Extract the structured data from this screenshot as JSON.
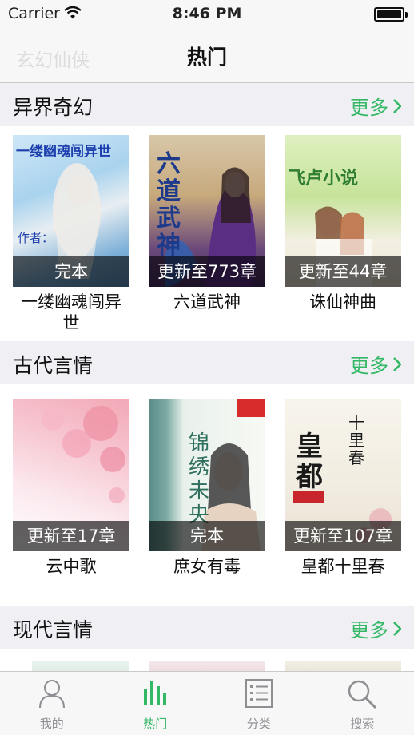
{
  "status": {
    "carrier": "Carrier",
    "time": "8:46 PM"
  },
  "nav": {
    "ghost_text": "玄幻仙侠",
    "title": "热门"
  },
  "sections": [
    {
      "name": "异界奇幻",
      "more": "更多",
      "books": [
        {
          "title": "一缕幽魂闯异世",
          "badge": "完本",
          "cover_text": "一缕幽魂闯异世",
          "cover_sub": "作者："
        },
        {
          "title": "六道武神",
          "badge": "更新至773章",
          "cover_text": "六道武神",
          "cover_sub": ""
        },
        {
          "title": "诛仙神曲",
          "badge": "更新至44章",
          "cover_text": "飞卢小说",
          "cover_sub": ""
        }
      ]
    },
    {
      "name": "古代言情",
      "more": "更多",
      "books": [
        {
          "title": "云中歌",
          "badge": "更新至17章",
          "cover_text": "",
          "cover_sub": ""
        },
        {
          "title": "庶女有毒",
          "badge": "完本",
          "cover_text": "锦绣未央",
          "cover_sub": ""
        },
        {
          "title": "皇都十里春",
          "badge": "更新至107章",
          "cover_text": "皇都",
          "cover_sub": "十里春"
        }
      ]
    },
    {
      "name": "现代言情",
      "more": "更多",
      "books": []
    }
  ],
  "tabs": [
    {
      "label": "我的",
      "icon": "person-icon"
    },
    {
      "label": "热门",
      "icon": "bar-chart-icon"
    },
    {
      "label": "分类",
      "icon": "list-icon"
    },
    {
      "label": "搜索",
      "icon": "search-icon"
    }
  ],
  "colors": {
    "accent": "#33b865",
    "section_bg": "#efeff4",
    "bar_bg": "#f7f7f7"
  }
}
